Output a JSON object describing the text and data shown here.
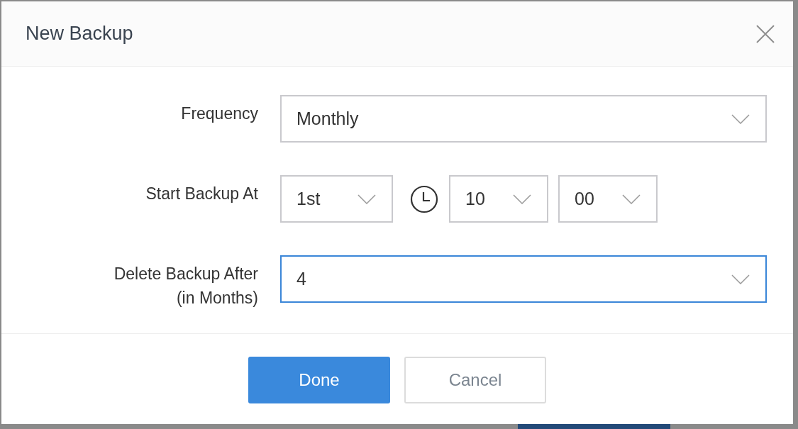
{
  "dialog": {
    "title": "New Backup",
    "fields": [
      {
        "label": "Frequency",
        "kind": "wide",
        "selects": [
          {
            "value": "Monthly",
            "focused": false
          }
        ]
      },
      {
        "label": "Start Backup At",
        "kind": "schedule",
        "selects": [
          {
            "value": "1st",
            "focused": false
          },
          {
            "value": "10",
            "focused": false
          },
          {
            "value": "00",
            "focused": false
          }
        ]
      },
      {
        "label": "Delete Backup After\n(in Months)",
        "kind": "wide",
        "selects": [
          {
            "value": "4",
            "focused": true
          }
        ]
      }
    ],
    "buttons": [
      {
        "label": "Done",
        "kind": "primary"
      },
      {
        "label": "Cancel",
        "kind": "secondary"
      }
    ]
  }
}
